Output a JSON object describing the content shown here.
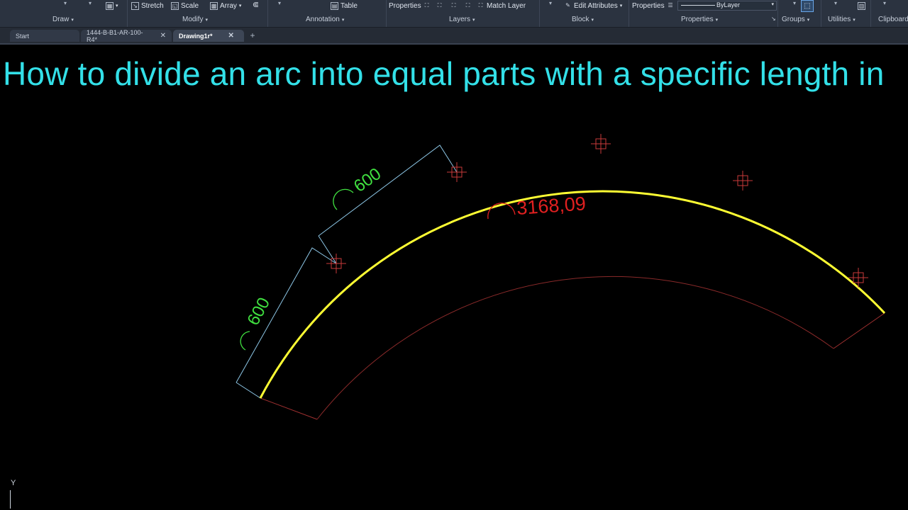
{
  "ribbon": {
    "tools": {
      "stretch": "Stretch",
      "scale": "Scale",
      "array": "Array",
      "table": "Table",
      "properties_layer": "Properties",
      "match_layer": "Match Layer",
      "edit_attributes": "Edit Attributes",
      "properties": "Properties",
      "bylayer": "ByLayer"
    },
    "panels": {
      "draw": "Draw",
      "modify": "Modify",
      "annotation": "Annotation",
      "layers": "Layers",
      "block": "Block",
      "properties": "Properties",
      "groups": "Groups",
      "utilities": "Utilities",
      "clipboard": "Clipboard"
    }
  },
  "tabs": [
    {
      "label": "Start",
      "closable": false,
      "active": false
    },
    {
      "label": "1444-B-B1-AR-100- R4*",
      "closable": true,
      "active": false
    },
    {
      "label": "Drawing1r*",
      "closable": true,
      "active": true
    }
  ],
  "canvas": {
    "headline": "How to divide an arc into equal parts with a specific length in",
    "ucs_label": "Y",
    "colors": {
      "background": "#000000",
      "headline": "#33e0e8",
      "arc": "#ffff33",
      "segment_dimension": "#40e040",
      "arc_length_dimension": "#e02020",
      "extension_lines_cyan": "#8ec8e8",
      "extension_lines_red": "#a03030",
      "point_markers": "#c83a3a"
    },
    "dimensions": {
      "segment_1": "600",
      "segment_2": "600",
      "arc_length": "3168,09"
    }
  }
}
